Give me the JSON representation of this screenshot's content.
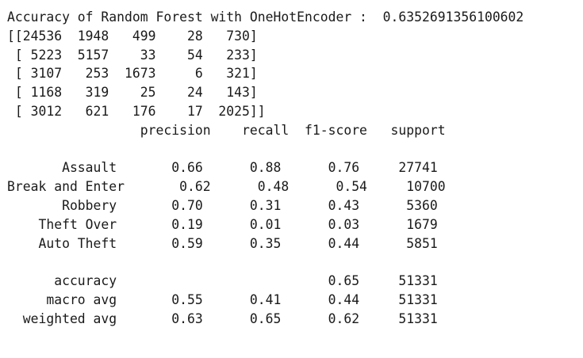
{
  "output": {
    "lines": [
      "Accuracy of Random Forest with OneHotEncoder :  0.6352691356100602",
      "[[24536  1948   499    28   730]",
      " [ 5223  5157    33    54   233]",
      " [ 3107   253  1673     6   321]",
      " [ 1168   319    25    24   143]",
      " [ 3012   621   176    17  2025]]",
      "                 precision    recall  f1-score   support",
      "",
      "       Assault       0.66      0.88      0.76     27741",
      "Break and Enter       0.62      0.48      0.54     10700",
      "       Robbery       0.70      0.31      0.43      5360",
      "    Theft Over       0.19      0.01      0.03      1679",
      "    Auto Theft       0.59      0.35      0.44      5851",
      "",
      "      accuracy                           0.65     51331",
      "     macro avg       0.55      0.41      0.44     51331",
      "  weighted avg       0.63      0.65      0.62     51331"
    ]
  }
}
